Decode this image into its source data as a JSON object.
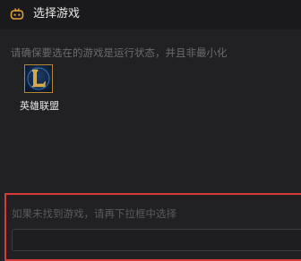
{
  "header": {
    "title": "选择游戏",
    "icon": "gamepad-icon"
  },
  "main": {
    "hint": "请确保要选在的游戏是运行状态，并且非最小化",
    "games": [
      {
        "label": "英雄联盟",
        "icon": "league-of-legends-icon"
      }
    ]
  },
  "fallback": {
    "hint": "如果未找到游戏，请再下拉框中选择",
    "select_value": ""
  },
  "colors": {
    "background": "#212124",
    "header_background": "#1a1a1c",
    "highlight_border": "#d83a3a",
    "accent_orange": "#e8a33c"
  }
}
